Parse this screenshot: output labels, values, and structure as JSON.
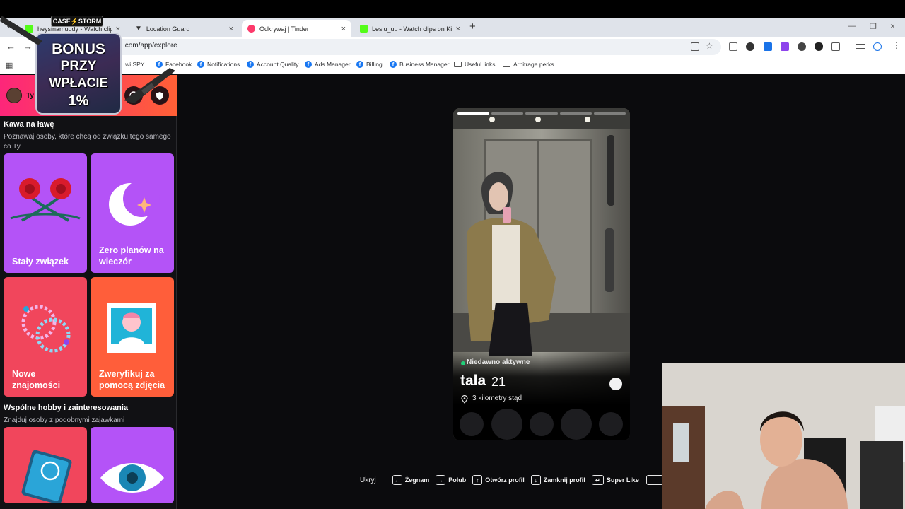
{
  "browser": {
    "tabs": [
      {
        "label": "heysinamuddy - Watch clips o",
        "active": false
      },
      {
        "label": "Location Guard",
        "active": false
      },
      {
        "label": "Odkrywaj | Tinder",
        "active": true
      },
      {
        "label": "Lesiu_uu - Watch clips on Kick",
        "active": false
      }
    ],
    "new_tab": "+",
    "url": ".com/app/explore",
    "bookmarks": [
      {
        "label": "...wi SPY..."
      },
      {
        "label": "Facebook"
      },
      {
        "label": "Notifications"
      },
      {
        "label": "Account Quality"
      },
      {
        "label": "Ads Manager"
      },
      {
        "label": "Billing"
      },
      {
        "label": "Business Manager"
      },
      {
        "label": "Useful links"
      },
      {
        "label": "Arbitrage perks"
      }
    ]
  },
  "sidebar": {
    "you_label": "Ty",
    "section1": {
      "title": "Kawa na ławę",
      "subtitle": "Poznawaj osoby, które chcą od związku tego samego co Ty"
    },
    "cards": [
      {
        "label": "Stały związek",
        "color": "#b453f7"
      },
      {
        "label": "Zero planów na wieczór",
        "color": "#b453f7"
      },
      {
        "label": "Nowe znajomości",
        "color": "#f1465c"
      },
      {
        "label": "Zweryfikuj za pomocą zdjęcia",
        "color": "#ff5e3a"
      }
    ],
    "section2": {
      "title": "Wspólne hobby i zainteresowania",
      "subtitle": "Znajduj osoby z podobnymi zajawkami"
    },
    "cards2": [
      {
        "color": "#f1465c"
      },
      {
        "color": "#b453f7"
      }
    ]
  },
  "profile": {
    "status": "Niedawno aktywne",
    "name": "tala",
    "age": "21",
    "distance": "3 kilometry stąd",
    "photo_count": 5,
    "current_photo": 1
  },
  "shortcuts": {
    "hide": "Ukryj",
    "nope": "Żegnam",
    "like": "Polub",
    "open": "Otwórz profil",
    "close": "Zamknij profil",
    "super": "Super Like"
  },
  "overlay": {
    "logo": "CASE⚡STORM",
    "promo_line1": "BONUS",
    "promo_line2": "PRZY",
    "promo_line3": "WPŁACIE",
    "promo_line4": "1%"
  },
  "colors": {
    "tinder_gradient_start": "#fd267a",
    "tinder_gradient_end": "#ff6036",
    "active_green": "#21d07a"
  }
}
